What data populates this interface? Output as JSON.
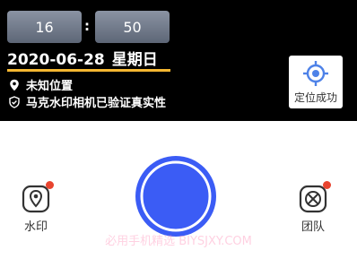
{
  "clock": {
    "hour": "16",
    "separator": ":",
    "minute": "50"
  },
  "date": {
    "date": "2020-06-28",
    "weekday": "星期日"
  },
  "location": {
    "text": "未知位置",
    "icon": "location-pin-icon"
  },
  "verification": {
    "text": "马克水印相机已验证真实性",
    "icon": "shield-check-icon"
  },
  "locate_button": {
    "label": "定位成功",
    "icon": "crosshair-icon"
  },
  "watermark_button": {
    "label": "水印",
    "icon": "watermark-pin-icon",
    "badge": true
  },
  "team_button": {
    "label": "团队",
    "icon": "team-aperture-icon",
    "badge": true
  },
  "shutter": {
    "icon": "shutter-icon",
    "color": "#3b5cf5"
  },
  "overlay_watermark": "必用手机精选 BIYSJXY.COM",
  "colors": {
    "accent_underline": "#f5b731",
    "badge": "#e8442f",
    "locate_icon": "#4e82e8"
  }
}
